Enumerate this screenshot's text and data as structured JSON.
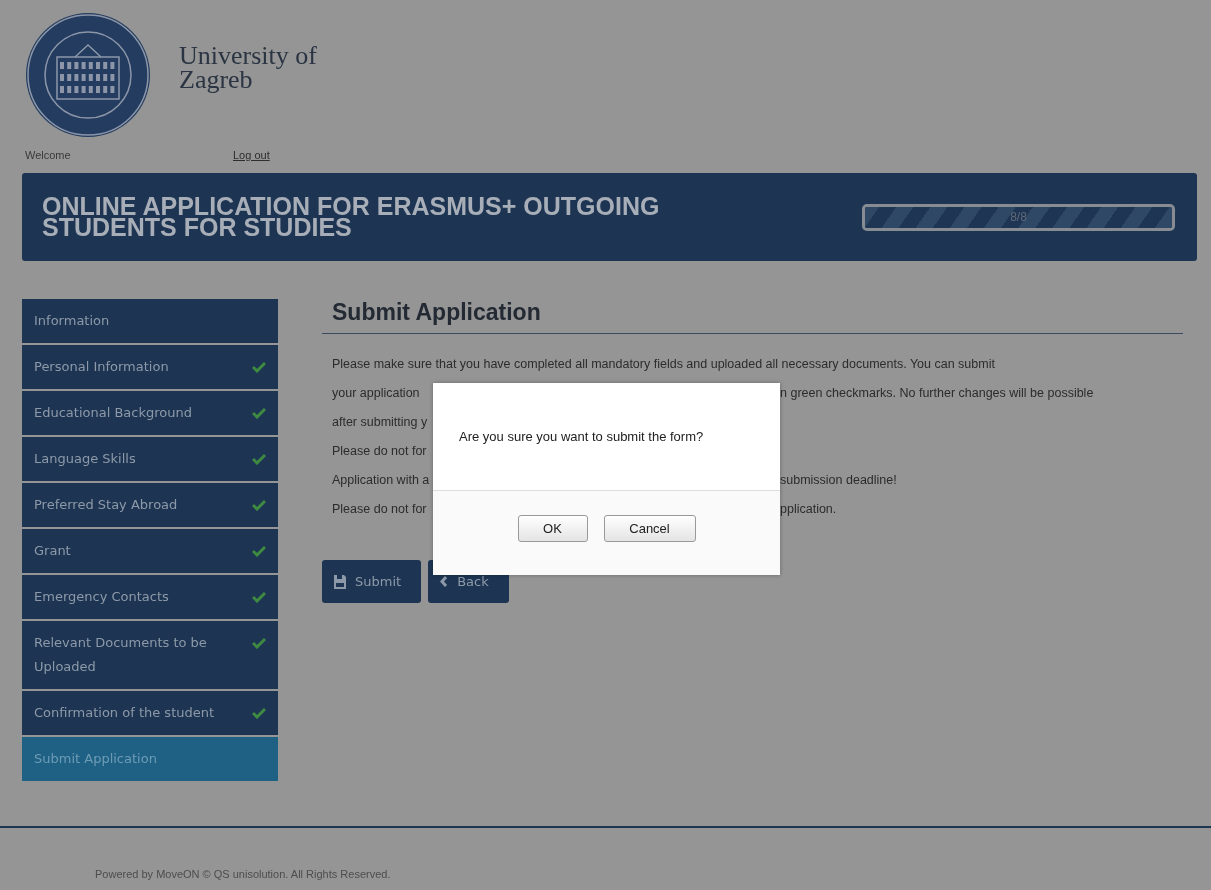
{
  "header": {
    "university_name": [
      "University of",
      "Zagreb"
    ],
    "welcome": "Welcome",
    "logout": "Log out"
  },
  "banner": {
    "title": "ONLINE APPLICATION FOR ERASMUS+ OUTGOING STUDENTS FOR STUDIES",
    "progress": {
      "label": "8/8",
      "level": 1
    }
  },
  "sidebar": {
    "items": [
      {
        "label": "Information",
        "checked": false,
        "selected": false
      },
      {
        "label": "Personal Information",
        "checked": true,
        "selected": false
      },
      {
        "label": "Educational Background",
        "checked": true,
        "selected": false
      },
      {
        "label": "Language Skills",
        "checked": true,
        "selected": false
      },
      {
        "label": "Preferred Stay Abroad",
        "checked": true,
        "selected": false
      },
      {
        "label": "Grant",
        "checked": true,
        "selected": false
      },
      {
        "label": "Emergency Contacts",
        "checked": true,
        "selected": false
      },
      {
        "label": "Relevant Documents to be Uploaded",
        "checked": true,
        "selected": false
      },
      {
        "label": "Confirmation of the student",
        "checked": true,
        "selected": false
      },
      {
        "label": "Submit Application",
        "checked": false,
        "selected": true
      }
    ]
  },
  "main": {
    "heading": "Submit Application",
    "lines": [
      {
        "left": "Please make sure that you have completed all mandatory fields and uploaded all necessary documents. You can submit"
      },
      {
        "left": "your application",
        "right": "n green checkmarks. No further changes will be possible"
      },
      {
        "left": "after submitting y"
      },
      {
        "left": "Please do not for"
      },
      {
        "left": "Application with a",
        "right": "submission deadline!"
      },
      {
        "left": "Please do not for",
        "right": "pplication."
      }
    ],
    "buttons": [
      {
        "kind": "submit",
        "label": "Submit"
      },
      {
        "kind": "back",
        "label": "Back"
      }
    ]
  },
  "dialog": {
    "message": "Are you sure you want to submit the form?",
    "buttons": [
      "OK",
      "Cancel"
    ]
  },
  "footer": {
    "text": "Powered by MoveON © QS unisolution. All Rights Reserved."
  }
}
